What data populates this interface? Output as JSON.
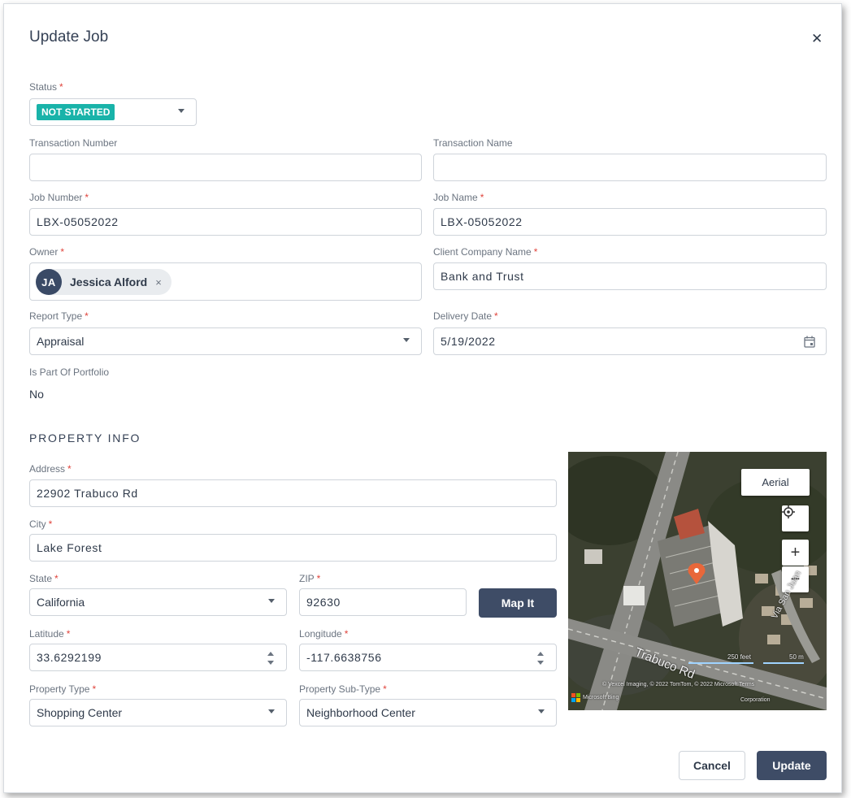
{
  "modal": {
    "title": "Update Job"
  },
  "status": {
    "label": "Status",
    "value": "NOT STARTED",
    "badge_color": "#19b3a9"
  },
  "transaction_number": {
    "label": "Transaction Number",
    "value": ""
  },
  "transaction_name": {
    "label": "Transaction Name",
    "value": ""
  },
  "job_number": {
    "label": "Job Number",
    "value": "LBX-05052022"
  },
  "job_name": {
    "label": "Job Name",
    "value": "LBX-05052022"
  },
  "owner": {
    "label": "Owner",
    "initials": "JA",
    "name": "Jessica Alford",
    "remove": "×"
  },
  "client_company": {
    "label": "Client Company Name",
    "value": "Bank and Trust"
  },
  "report_type": {
    "label": "Report Type",
    "value": "Appraisal"
  },
  "delivery_date": {
    "label": "Delivery Date",
    "value": "5/19/2022"
  },
  "portfolio": {
    "label": "Is Part Of Portfolio",
    "value": "No"
  },
  "property_info": {
    "heading": "PROPERTY INFO",
    "address": {
      "label": "Address",
      "value": "22902 Trabuco Rd"
    },
    "city": {
      "label": "City",
      "value": "Lake Forest"
    },
    "state": {
      "label": "State",
      "value": "California"
    },
    "zip": {
      "label": "ZIP",
      "value": "92630"
    },
    "map_it": "Map It",
    "latitude": {
      "label": "Latitude",
      "value": "33.6292199"
    },
    "longitude": {
      "label": "Longitude",
      "value": "-117.6638756"
    },
    "property_type": {
      "label": "Property Type",
      "value": "Shopping Center"
    },
    "property_subtype": {
      "label": "Property Sub-Type",
      "value": "Neighborhood Center"
    }
  },
  "map": {
    "aerial_label": "Aerial",
    "zoom_in": "+",
    "zoom_out": "−",
    "road_label": "Trabuco Rd",
    "side_road_label": "Via San Juan",
    "scale_ft": "250 feet",
    "scale_m": "50 m",
    "attribution": "© Vexcel Imaging, © 2022 TomTom, © 2022 Microsoft  Terms",
    "attribution2": "Corporation",
    "brand": "Microsoft Bing",
    "pin_color": "#e8673a"
  },
  "buttons": {
    "cancel": "Cancel",
    "update": "Update"
  },
  "colors": {
    "primary": "#3e4c66",
    "required": "#e0443c"
  }
}
